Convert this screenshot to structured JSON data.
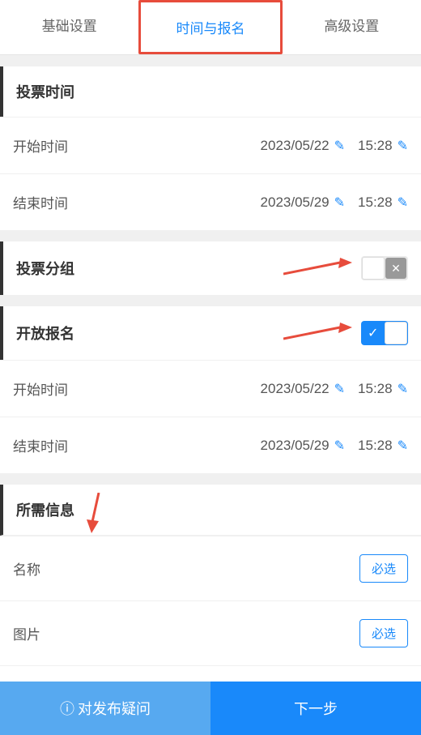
{
  "tabs": {
    "basic": "基础设置",
    "time": "时间与报名",
    "advanced": "高级设置"
  },
  "voting_time": {
    "title": "投票时间",
    "start_label": "开始时间",
    "start_date": "2023/05/22",
    "start_time": "15:28",
    "end_label": "结束时间",
    "end_date": "2023/05/29",
    "end_time": "15:28"
  },
  "voting_group": {
    "title": "投票分组"
  },
  "open_signup": {
    "title": "开放报名",
    "start_label": "开始时间",
    "start_date": "2023/05/22",
    "start_time": "15:28",
    "end_label": "结束时间",
    "end_date": "2023/05/29",
    "end_time": "15:28"
  },
  "required_info": {
    "title": "所需信息",
    "name_label": "名称",
    "name_badge": "必选",
    "image_label": "图片",
    "image_badge": "必选"
  },
  "footer": {
    "question": "对发布疑问",
    "next": "下一步"
  }
}
